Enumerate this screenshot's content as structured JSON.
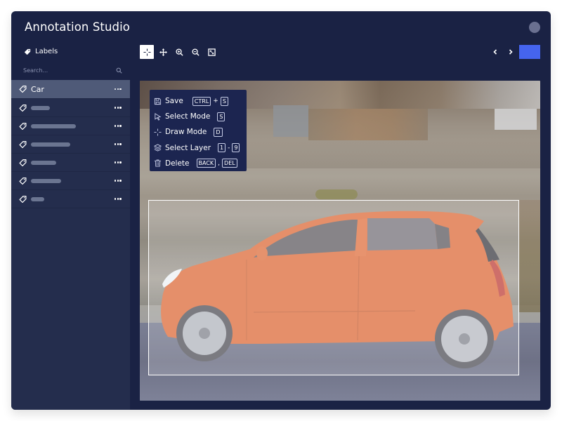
{
  "app": {
    "title": "Annotation Studio"
  },
  "sidebar": {
    "header": "Labels",
    "search": {
      "placeholder": "Search...",
      "value": ""
    },
    "items": [
      {
        "label": "Car",
        "active": true
      },
      {
        "label": null,
        "placeholder_bar": "short"
      },
      {
        "label": null,
        "placeholder_bar": "long"
      },
      {
        "label": null,
        "placeholder_bar": "medium-long"
      },
      {
        "label": null,
        "placeholder_bar": "medium-short"
      },
      {
        "label": null,
        "placeholder_bar": "medium"
      },
      {
        "label": null,
        "placeholder_bar": "tiny"
      }
    ]
  },
  "toolbar": {
    "tools": [
      {
        "name": "draw-tool",
        "icon": "crosshair-icon",
        "active": true
      },
      {
        "name": "pan-tool",
        "icon": "move-icon",
        "active": false
      },
      {
        "name": "zoom-in-tool",
        "icon": "zoom-in-icon",
        "active": false
      },
      {
        "name": "zoom-out-tool",
        "icon": "zoom-out-icon",
        "active": false
      },
      {
        "name": "fit-tool",
        "icon": "fit-screen-icon",
        "active": false
      }
    ],
    "prev_icon": "chevron-left-icon",
    "next_icon": "chevron-right-icon"
  },
  "hotkeys": [
    {
      "icon": "save-icon",
      "label": "Save",
      "keys": [
        "CTRL",
        "+",
        "S"
      ]
    },
    {
      "icon": "cursor-icon",
      "label": "Select Mode",
      "keys": [
        "S"
      ]
    },
    {
      "icon": "crosshair-icon",
      "label": "Draw Mode",
      "keys": [
        "D"
      ]
    },
    {
      "icon": "layers-icon",
      "label": "Select Layer",
      "keys": [
        "1",
        "-",
        "9"
      ]
    },
    {
      "icon": "trash-icon",
      "label": "Delete",
      "keys": [
        "BACK",
        ",",
        "DEL"
      ]
    }
  ],
  "annotation": {
    "label": "Car"
  },
  "colors": {
    "window_bg": "#1a2244",
    "sidebar_bg": "#242d4d",
    "active_item": "#4f5a78",
    "accent": "#4564ee",
    "panel_bg": "#1c2550"
  }
}
